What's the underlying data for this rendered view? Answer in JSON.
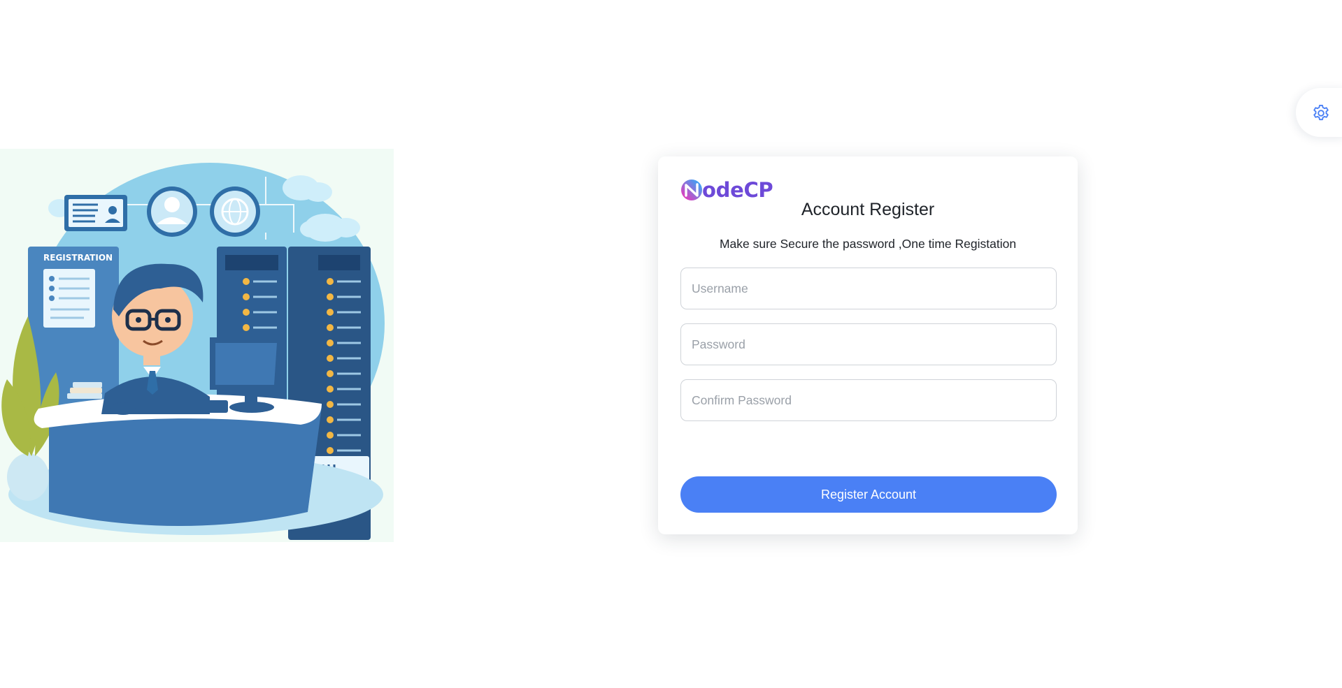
{
  "colors": {
    "primary": "#4a80f5",
    "logo_gradient": [
      "#ff2bb3",
      "#1fb6ff"
    ],
    "logo_text": "#6d49d8",
    "illustration_background": "#f1fbf5"
  },
  "illustration": {
    "sign_text": "REGISTRATION"
  },
  "settings": {
    "icon": "gear-icon"
  },
  "brand": {
    "logo_text": "odeCP",
    "logo_icon": "n-logo-icon"
  },
  "register": {
    "title": "Account Register",
    "subtitle": "Make sure Secure the password ,One time Registation",
    "username_placeholder": "Username",
    "password_placeholder": "Password",
    "confirm_placeholder": "Confirm Password",
    "submit_label": "Register Account"
  }
}
